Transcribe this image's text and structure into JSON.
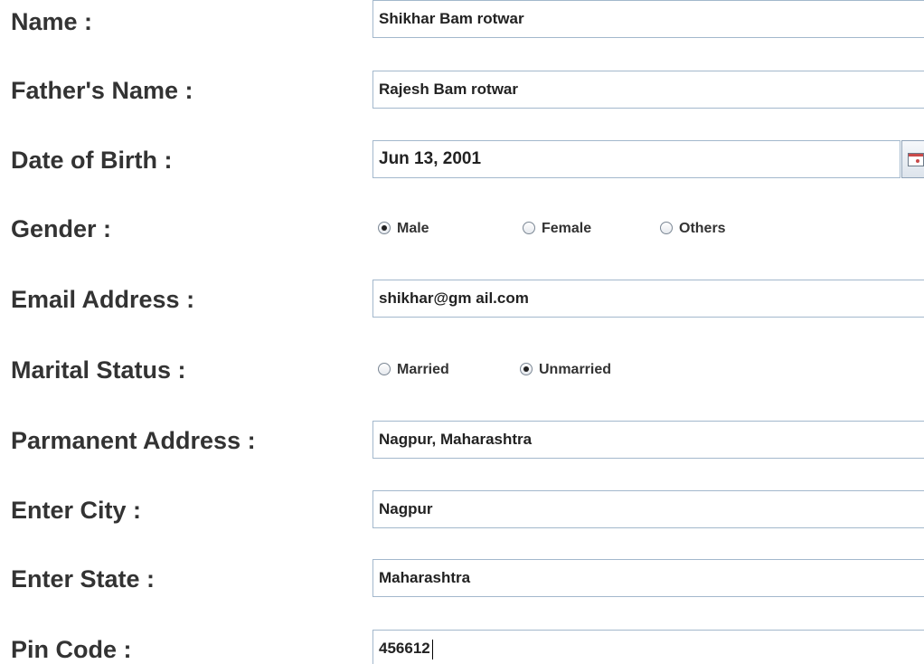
{
  "labels": {
    "name": "Name :",
    "father_name": "Father's Name :",
    "dob": "Date of Birth :",
    "gender": "Gender :",
    "email": "Email Address :",
    "marital_status": "Marital Status :",
    "address": "Parmanent Address :",
    "city": "Enter City :",
    "state": "Enter State :",
    "pin": "Pin Code :"
  },
  "values": {
    "name": "Shikhar Bam rotwar",
    "father_name": "Rajesh Bam rotwar",
    "dob": "Jun 13, 2001",
    "email": "shikhar@gm ail.com",
    "address": "Nagpur, Maharashtra",
    "city": "Nagpur",
    "state": "Maharashtra",
    "pin": "456612"
  },
  "gender": {
    "options": [
      "Male",
      "Female",
      "Others"
    ],
    "selected": "Male"
  },
  "marital_status": {
    "options": [
      "Married",
      "Unmarried"
    ],
    "selected": "Unmarried"
  },
  "icons": {
    "date_picker": "calendar-icon"
  }
}
